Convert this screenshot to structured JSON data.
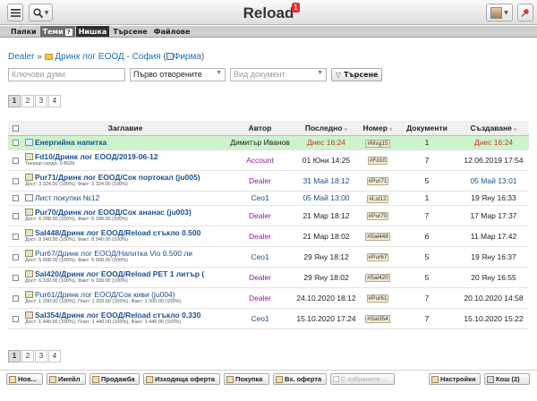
{
  "app": {
    "name": "Reload",
    "notifications": "1"
  },
  "tabs": [
    "Папки",
    "Теми",
    "Нишка",
    "Търсене",
    "Файлове"
  ],
  "breadcrumb": {
    "root": "Dealer",
    "sep": "»",
    "company": "Дринк лог ЕООД - София",
    "firm_link": "Фирма"
  },
  "filters": {
    "keywords_placeholder": "Ключови думи",
    "order": "Първо отворените",
    "doc_type_placeholder": "Вид документ",
    "search_btn": "Търсене"
  },
  "pager": [
    "1",
    "2",
    "3",
    "4"
  ],
  "columns": {
    "title": "Заглавие",
    "author": "Автор",
    "last": "Последно",
    "number": "Номер",
    "docs": "Документи",
    "created": "Създаване"
  },
  "rows": [
    {
      "title": "Енергийна напитка",
      "sub": "",
      "author": "Димитър Иванов",
      "last": "Днес 16:24",
      "number": "#Msg15",
      "docs": "1",
      "created": "Днес 16:24"
    },
    {
      "title": "Fd10/Дринк лог ЕООД/2019-06-12",
      "sub": "Текущо салдо: 0 BGN",
      "author": "Account",
      "last": "01 Юни 14:25",
      "number": "#Fd10",
      "docs": "7",
      "created": "12.06.2019 17:54"
    },
    {
      "title": "Pur71/Дринк лог ЕООД/Сок портокал (ju005)",
      "sub": "Дост: 3 324.00 (100%), Факт: 3 324.00 (100%)",
      "author": "Dealer",
      "last": "31 Май 18:12",
      "number": "#Pur71",
      "docs": "5",
      "created": "05 Май 13:01"
    },
    {
      "title": "Лист покупки №12",
      "sub": "",
      "author": "Ceo1",
      "last": "05 Май 13:00",
      "number": "#Lst12",
      "docs": "1",
      "created": "19 Яну 16:33"
    },
    {
      "title": "Pur70/Дринк лог ЕООД/Сок ананас (ju003)",
      "sub": "Дост: 6 288.00 (100%), Факт: 6 288.00 (100%)",
      "author": "Dealer",
      "last": "21 Мар 18:12",
      "number": "#Pur70",
      "docs": "7",
      "created": "17 Мар 17:37"
    },
    {
      "title": "Sal448/Дринк лог ЕООД/Reload стъкло 0.500",
      "sub": "Дост: 8 940.00 (100%), Факт: 8 940.00 (100%)",
      "author": "Dealer",
      "last": "21 Мар 18:02",
      "number": "#Sal448",
      "docs": "6",
      "created": "11 Мар 17:42"
    },
    {
      "title": "Pur67/Дринк лог ЕООД/Напитка Vio 0.500 ли",
      "sub": "Дост: 5 568.00 (100%), Факт: 5 568.00 (100%)",
      "author": "Ceo1",
      "last": "29 Яну 18:12",
      "number": "#Pur67",
      "docs": "5",
      "created": "19 Яну 16:37"
    },
    {
      "title": "Sal420/Дринк лог ЕООД/Reload PET 1 литър (",
      "sub": "Дост: 6 330.00 (100%), Факт: 6 330.00 (100%)",
      "author": "Dealer",
      "last": "29 Яну 18:02",
      "number": "#Sal420",
      "docs": "5",
      "created": "20 Яну 16:55"
    },
    {
      "title": "Pur61/Дринк лог ЕООД/Сок киви (ju004)",
      "sub": "Дост: 1 200.00 (100%), Плат: 1 200.00 (100%), Факт: 1 200.00 (100%)",
      "author": "Dealer",
      "last": "24.10.2020 18:12",
      "number": "#Pur61",
      "docs": "7",
      "created": "20.10.2020 14:58"
    },
    {
      "title": "Sal354/Дринк лог ЕООД/Reload стъкло 0.330",
      "sub": "Дост: 1 440.00 (100%), Плат: 1 440.00 (100%), Факт: 1 440.00 (100%)",
      "author": "Ceo1",
      "last": "15.10.2020 17:24",
      "number": "#Sal354",
      "docs": "7",
      "created": "15.10.2020 15:22"
    }
  ],
  "bottom_buttons": {
    "new": "Нов...",
    "email": "Имейл",
    "sale": "Продажба",
    "outgoing_offer": "Изходяща оферта",
    "purchase": "Покупка",
    "incoming_offer": "Вх. оферта",
    "with_selected": "С избраните ...",
    "settings": "Настройки",
    "bin": "Кош (2)"
  },
  "colors": {
    "highlight": "#ccf3cc",
    "today": "#c0392b",
    "link": "#1b4f90",
    "author_dealer": "#8a1e9e"
  }
}
